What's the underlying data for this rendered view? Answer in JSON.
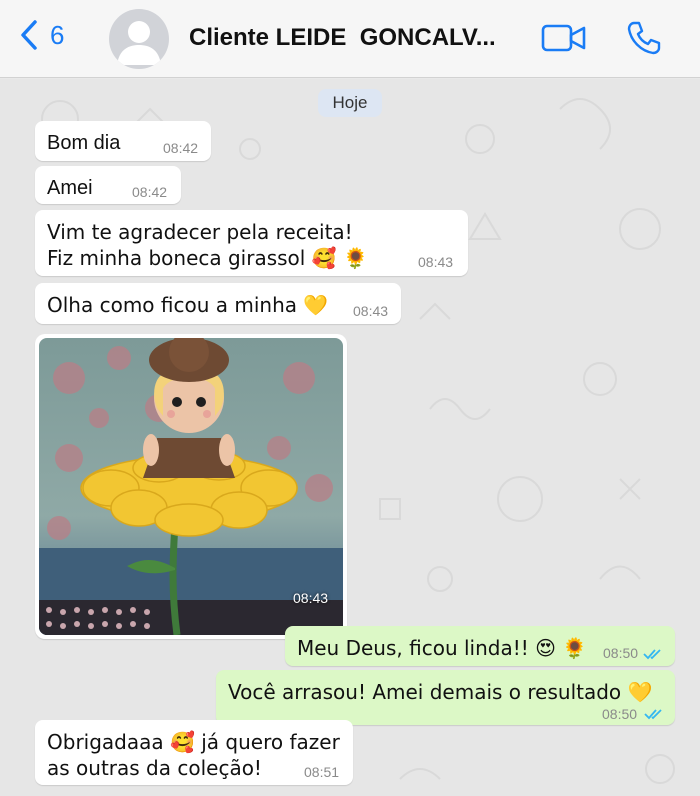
{
  "header": {
    "unread_count": "6",
    "contact_name": "Cliente LEIDE  GONCALV..."
  },
  "chat": {
    "day_label": "Hoje",
    "messages": [
      {
        "text": "Bom dia",
        "time": "08:42"
      },
      {
        "text": "Amei",
        "time": "08:42"
      },
      {
        "text": "Vim te agradecer pela receita!\nFiz minha boneca girassol 🥰 🌻",
        "time": "08:43"
      },
      {
        "text": "Olha como ficou a minha 💛",
        "time": "08:43"
      },
      {
        "photo_time": "08:43"
      },
      {
        "text": "Meu Deus, ficou linda!! 😍 🌻",
        "time": "08:50"
      },
      {
        "text": "Você arrasou! Amei demais o resultado 💛",
        "time": "08:50"
      },
      {
        "text": "Obrigadaaa 🥰 já quero fazer\nas outras da coleção!",
        "time": "08:51"
      }
    ]
  },
  "colors": {
    "accent": "#1a7cf5",
    "incoming_bubble": "#ffffff",
    "outgoing_bubble": "#dcf8c6",
    "read_ticks": "#34b7f1"
  },
  "icons": [
    "chevron-left-icon",
    "avatar-placeholder-icon",
    "video-camera-icon",
    "phone-icon",
    "double-check-icon"
  ]
}
